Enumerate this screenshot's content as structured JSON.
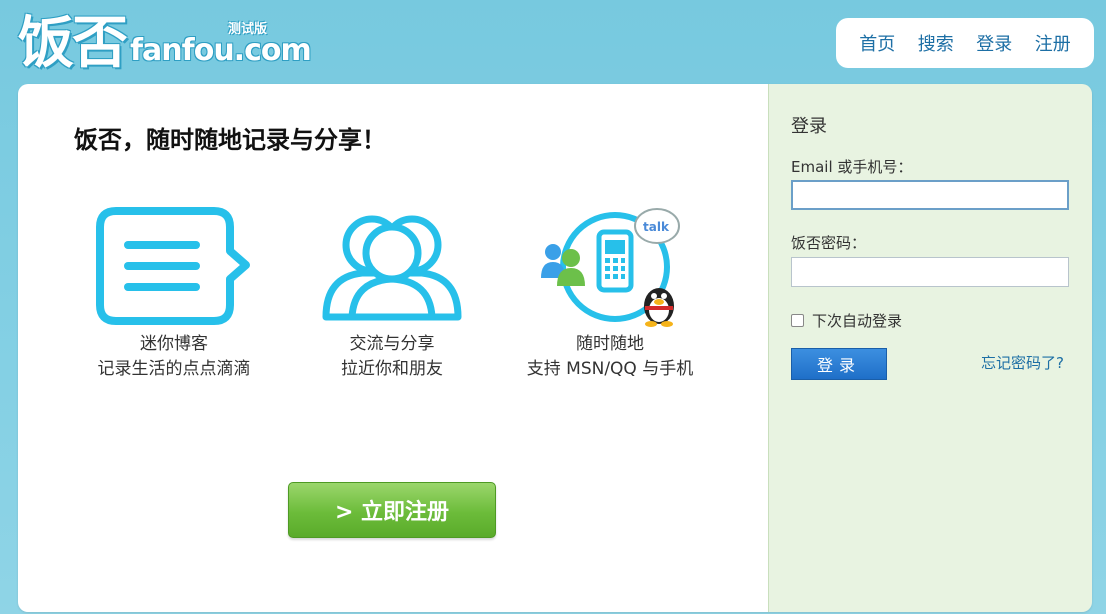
{
  "header": {
    "logo_cn": "饭否",
    "logo_en": "fanfou.com",
    "logo_beta": "测试版",
    "nav": [
      "首页",
      "搜索",
      "登录",
      "注册"
    ]
  },
  "main": {
    "headline": "饭否，随时随地记录与分享！",
    "features": [
      {
        "icon": "chat-bubble-icon",
        "line1": "迷你博客",
        "line2": "记录生活的点点滴滴"
      },
      {
        "icon": "friends-icon",
        "line1": "交流与分享",
        "line2": "拉近你和朋友"
      },
      {
        "icon": "messenger-phone-icon",
        "line1": "随时随地",
        "line2": "支持 MSN/QQ 与手机"
      }
    ],
    "register_label": "> 立即注册"
  },
  "login": {
    "title": "登录",
    "email_label": "Email 或手机号：",
    "email_value": "",
    "password_label": "饭否密码：",
    "password_value": "",
    "remember_label": "下次自动登录",
    "remember_checked": false,
    "submit_label": "登录",
    "forgot_label": "忘记密码了?"
  },
  "colors": {
    "background": "#77c9df",
    "link": "#1d6fa5",
    "icon_cyan": "#27c0ea",
    "register_green": "#6cbc3a",
    "login_blue": "#1f6fc8",
    "login_panel": "#e8f3e1"
  }
}
